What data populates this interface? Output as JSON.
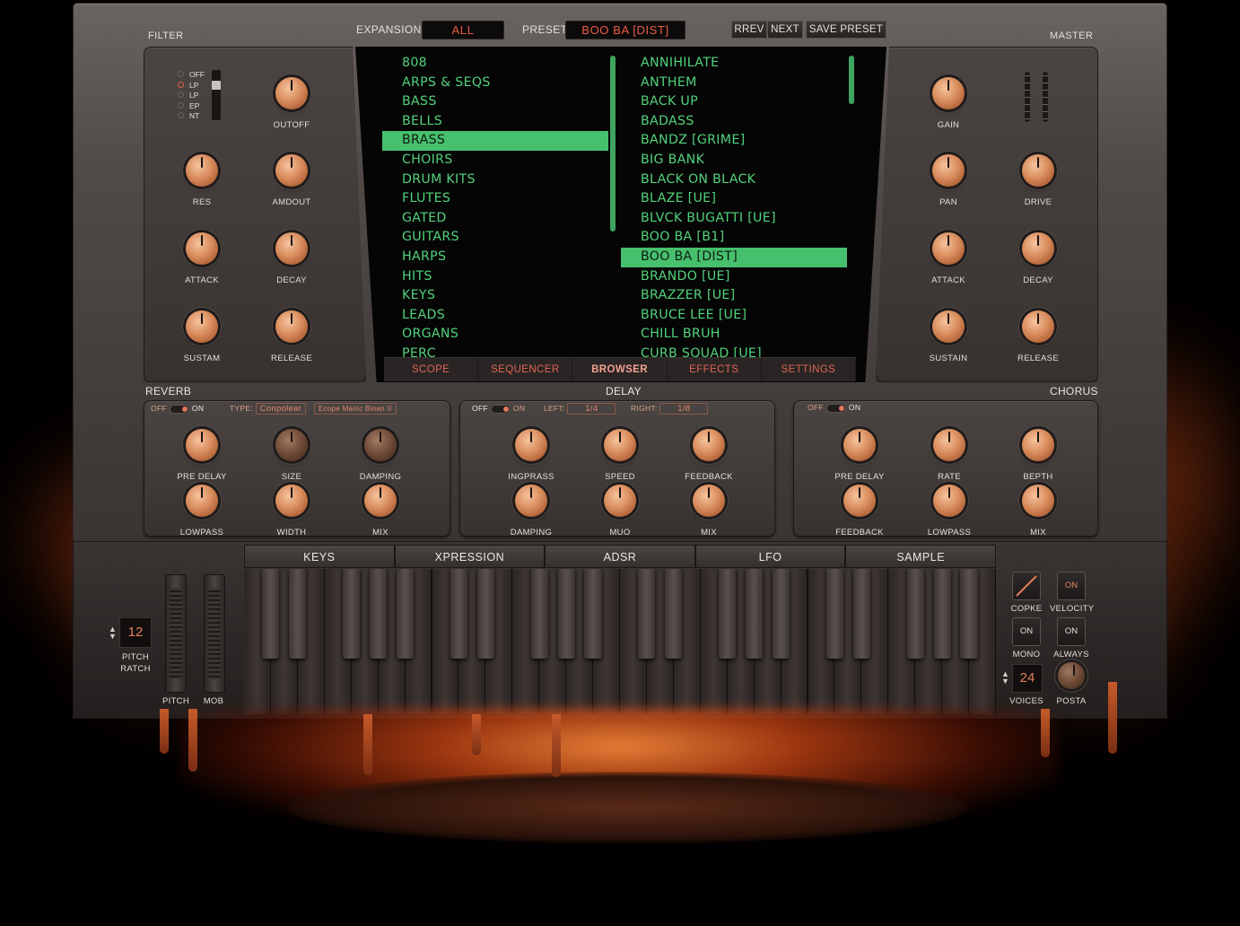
{
  "header": {
    "expansion_label": "EXPANSION",
    "expansion_value": "ALL",
    "preset_label": "PRESET",
    "preset_value": "BOO BA [DIST]",
    "prev_label": "RREV",
    "next_label": "NEXT",
    "save_label": "SAVE PRESET"
  },
  "filter": {
    "title": "FILTER",
    "modes": [
      "OFF",
      "LP",
      "LP",
      "EP",
      "NT"
    ],
    "knobs": [
      "OUTOFF",
      "RES",
      "AMDOUT",
      "ATTACK",
      "DECAY",
      "SUSTAM",
      "RELEASE"
    ]
  },
  "master": {
    "title": "MASTER",
    "knobs": [
      "GAIN",
      "PAN",
      "DRIVE",
      "ATTACK",
      "DECAY",
      "SUSTAIN",
      "RELEASE"
    ]
  },
  "browser": {
    "categories": [
      "808",
      "ARPS & SEQS",
      "BASS",
      "BELLS",
      "BRASS",
      "CHOIRS",
      "DRUM KITS",
      "FLUTES",
      "GATED",
      "GUITARS",
      "HARPS",
      "HITS",
      "KEYS",
      "LEADS",
      "ORGANS",
      "PERC"
    ],
    "selected_category": "BRASS",
    "presets": [
      "ANNIHILATE",
      "ANTHEM",
      "BACK UP",
      "BADASS",
      "BANDZ [GRIME]",
      "BIG BANK",
      "BLACK ON BLACK",
      "BLAZE [UE]",
      "BLVCK BUGATTI [UE]",
      "BOO BA [B1]",
      "BOO BA [DIST]",
      "BRANDO [UE]",
      "BRAZZER [UE]",
      "BRUCE LEE [UE]",
      "CHILL BRUH",
      "CURB SQUAD [UE]"
    ],
    "selected_preset": "BOO BA [DIST]",
    "tabs": [
      "SCOPE",
      "SEQUENCER",
      "BROWSER",
      "EFFECTS",
      "SETTINGS"
    ],
    "active_tab": "BROWSER"
  },
  "reverb": {
    "title": "REVERB",
    "off": "OFF",
    "on": "ON",
    "type_label": "TYPE:",
    "type_value": "Conpolear",
    "model_value": "Ecope Manic Bioan II",
    "knobs": [
      "PRE DELAY",
      "SIZE",
      "DAMPING",
      "LOWPASS",
      "WIDTH",
      "MIX"
    ]
  },
  "delay": {
    "title": "DELAY",
    "off": "OFF",
    "on": "ON",
    "left_label": "LEFT:",
    "left_value": "1/4",
    "right_label": "RIGHT:",
    "right_value": "1/8",
    "knobs": [
      "INGPRASS",
      "SPEED",
      "FEEDBACK",
      "DAMPING",
      "MUO",
      "MIX"
    ]
  },
  "chorus": {
    "title": "CHORUS",
    "off": "OFF",
    "on": "ON",
    "knobs": [
      "PRE DELAY",
      "RATE",
      "BEPTH",
      "FEEDBACK",
      "LOWPASS",
      "MIX"
    ]
  },
  "keyboard": {
    "tabs": [
      "KEYS",
      "XPRESSION",
      "ADSR",
      "LFO",
      "SAMPLE"
    ],
    "pitch_range_value": "12",
    "pitch_range_label": "PITCH\nRATCH",
    "pitch_label": "PITCH",
    "mod_label": "MOB",
    "curve_label": "COPKE",
    "velocity_btn": "ON",
    "velocity_label": "VELOCITY",
    "mono_btn": "ON",
    "mono_label": "MONO",
    "always_btn": "ON",
    "always_label": "ALWAYS",
    "voices_value": "24",
    "voices_label": "VOICES",
    "porta_label": "POSTA"
  },
  "colors": {
    "accent_green": "#46c06c",
    "accent_red": "#ef5b48",
    "knob_copper": "#d98d5d"
  }
}
